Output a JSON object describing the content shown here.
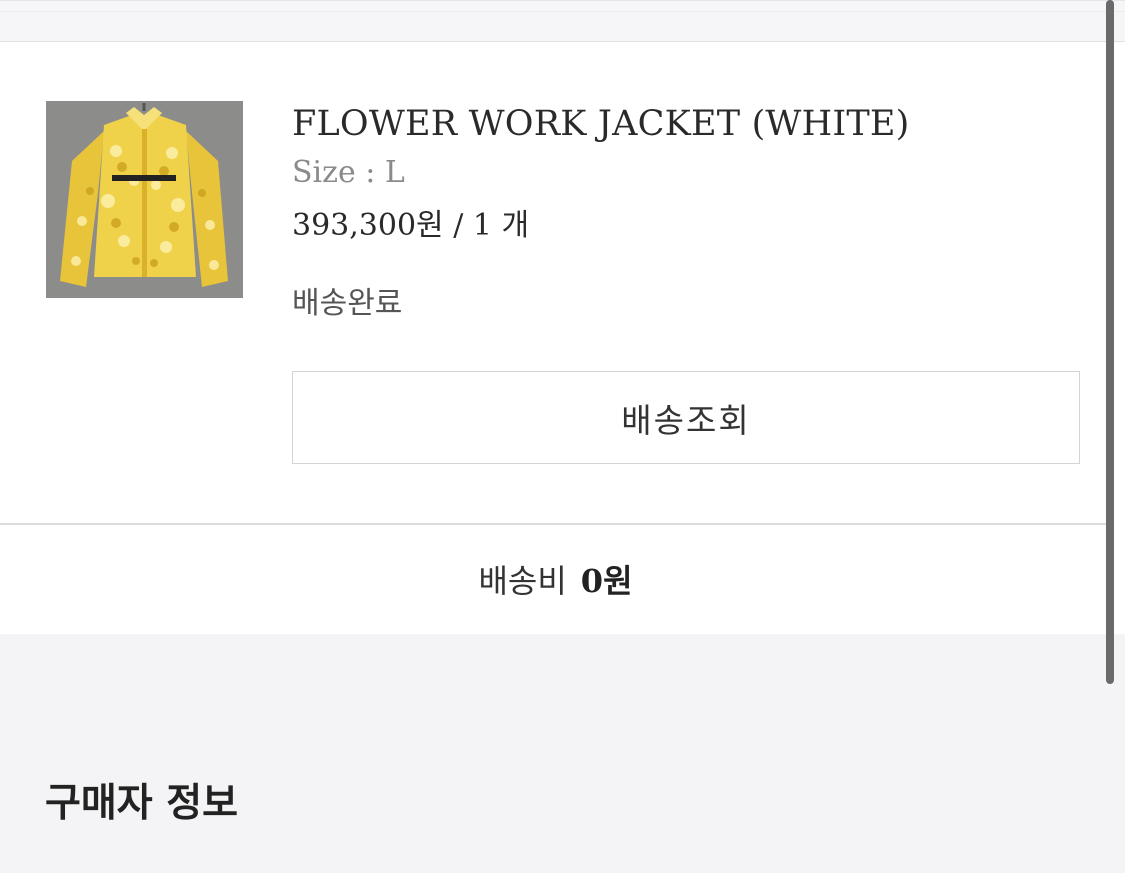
{
  "order_item": {
    "product_name": "FLOWER WORK JACKET (WHITE)",
    "size_text": "Size : L",
    "price_text": "393,300원 / 1 개",
    "status_text": "배송완료",
    "image_icon": "product-thumbnail-yellow-flower-jacket"
  },
  "actions": {
    "track_label": "배송조회"
  },
  "shipping": {
    "label": "배송비",
    "value": "0원"
  },
  "buyer_section": {
    "title": "구매자 정보"
  },
  "colors": {
    "background": "#f4f4f6",
    "card": "#ffffff",
    "border": "#d4d4d8",
    "thumbnail_bg": "#8c8c8a",
    "jacket_yellow": "#e8c43a"
  }
}
